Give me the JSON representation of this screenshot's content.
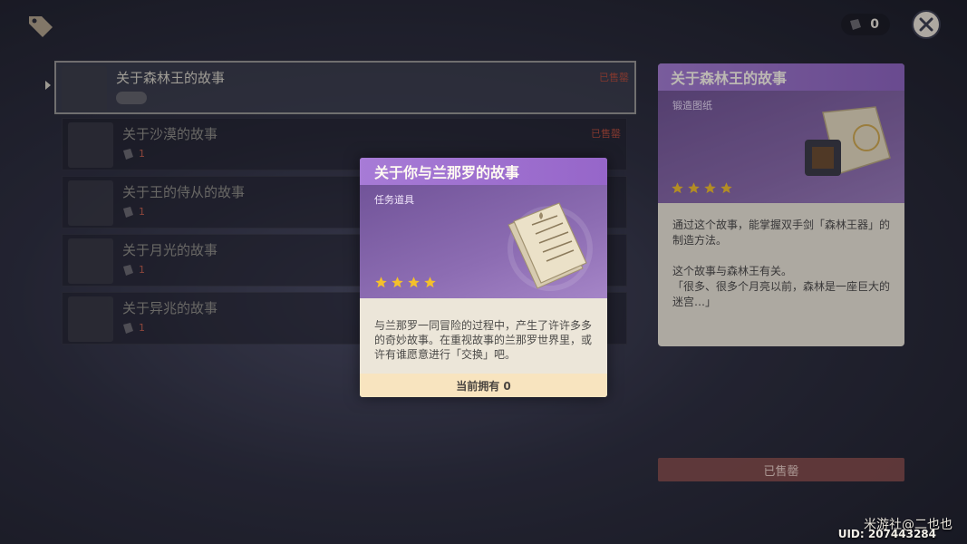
{
  "currency": {
    "value": "0",
    "icon": "material-icon"
  },
  "list": [
    {
      "name": "关于森林王的故事",
      "status": "已售罄",
      "mat_count": "",
      "selected": true
    },
    {
      "name": "关于沙漠的故事",
      "status": "已售罄",
      "mat_count": "1",
      "selected": false
    },
    {
      "name": "关于王的侍从的故事",
      "status": "",
      "mat_count": "1",
      "selected": false
    },
    {
      "name": "关于月光的故事",
      "status": "",
      "mat_count": "1",
      "selected": false
    },
    {
      "name": "关于异兆的故事",
      "status": "",
      "mat_count": "1",
      "selected": false
    }
  ],
  "detail": {
    "title": "关于森林王的故事",
    "type": "锻造图纸",
    "stars": 4,
    "desc1": "通过这个故事，能掌握双手剑「森林王器」的制造方法。",
    "desc2": "这个故事与森林王有关。",
    "desc3": "「很多、很多个月亮以前，森林是一座巨大的迷宫…」",
    "button": "已售罄"
  },
  "popup": {
    "title": "关于你与兰那罗的故事",
    "type": "任务道具",
    "stars": 4,
    "desc": "与兰那罗一同冒险的过程中，产生了许许多多的奇妙故事。在重视故事的兰那罗世界里，或许有谁愿意进行「交换」吧。",
    "owned": "当前拥有 0"
  },
  "watermark": "米游社@二也也",
  "uid": "UID: 207443284",
  "colors": {
    "star": "#f4c02b",
    "purple": "#9a6ccc",
    "sold": "#b14a3a"
  }
}
